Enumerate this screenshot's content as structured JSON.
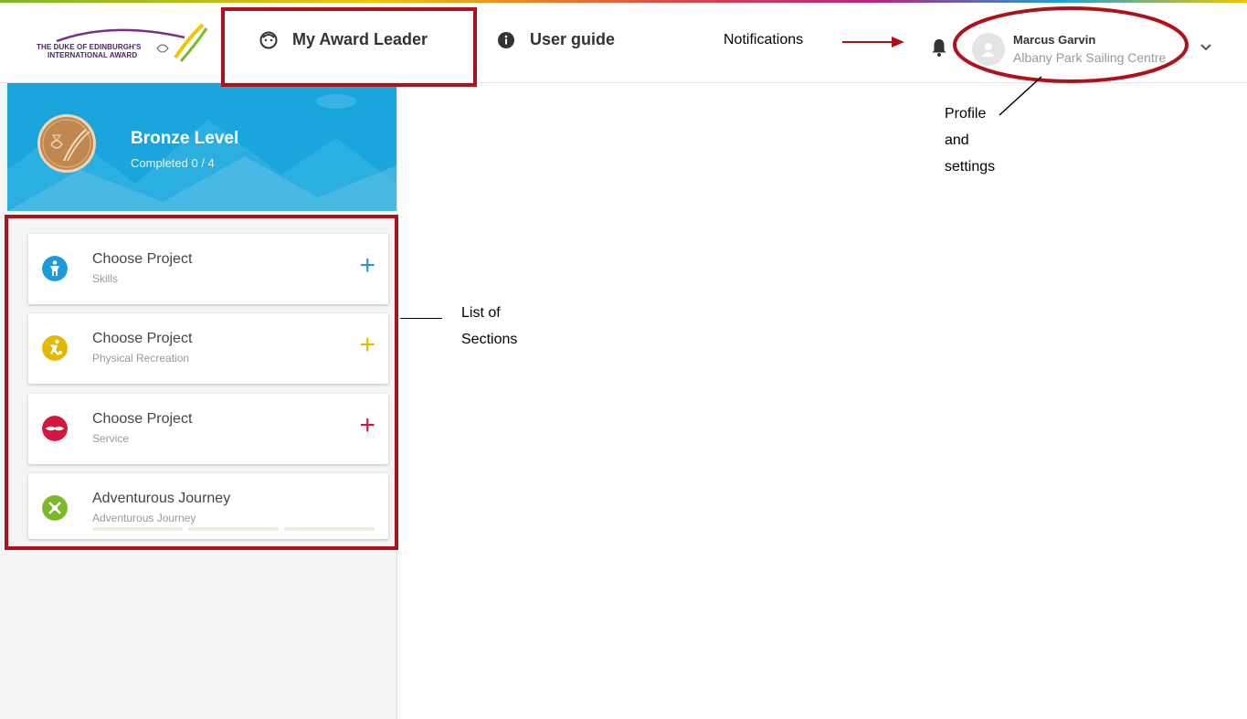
{
  "header": {
    "logo_line1": "THE DUKE OF EDINBURGH'S",
    "logo_line2": "INTERNATIONAL AWARD",
    "nav_award_leader": "My Award Leader",
    "nav_user_guide": "User guide"
  },
  "user": {
    "name": "Marcus Garvin",
    "org": "Albany Park Sailing Centre"
  },
  "level": {
    "title": "Bronze Level",
    "completed": "Completed 0 / 4"
  },
  "sections": [
    {
      "title": "Choose Project",
      "subtitle": "Skills",
      "icon": "skills-icon",
      "color": "#1c9ad6"
    },
    {
      "title": "Choose Project",
      "subtitle": "Physical Recreation",
      "icon": "physical-recreation-icon",
      "color": "#e2b800"
    },
    {
      "title": "Choose Project",
      "subtitle": "Service",
      "icon": "service-icon",
      "color": "#d3173f"
    },
    {
      "title": "Adventurous Journey",
      "subtitle": "Adventurous Journey",
      "icon": "adventurous-journey-icon",
      "color": "#7ab929"
    }
  ],
  "annotations": {
    "notifications": "Notifications",
    "profile_line1": "Profile",
    "profile_line2": "and",
    "profile_line3": "settings",
    "sections_line1": "List of",
    "sections_line2": "Sections"
  },
  "colors": {
    "annotation_red": "#b01119",
    "banner_blue": "#1aa6dc",
    "bronze": "#c0874f"
  }
}
